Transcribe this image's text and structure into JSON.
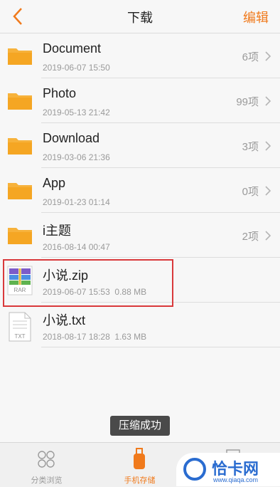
{
  "header": {
    "title": "下载",
    "edit_label": "编辑"
  },
  "files": [
    {
      "name": "Document",
      "date": "2019-06-07 15:50",
      "count": "6项",
      "icon": "folder-icon"
    },
    {
      "name": "Photo",
      "date": "2019-05-13 21:42",
      "count": "99项",
      "icon": "folder-icon"
    },
    {
      "name": "Download",
      "date": "2019-03-06 21:36",
      "count": "3项",
      "icon": "folder-icon"
    },
    {
      "name": "App",
      "date": "2019-01-23 01:14",
      "count": "0项",
      "icon": "folder-icon"
    },
    {
      "name": "i主题",
      "date": "2016-08-14 00:47",
      "count": "2项",
      "icon": "folder-icon"
    },
    {
      "name": "小说.zip",
      "date": "2019-06-07 15:53",
      "size": "0.88 MB",
      "icon": "rar-icon",
      "icon_label": "RAR"
    },
    {
      "name": "小说.txt",
      "date": "2018-08-17 18:28",
      "size": "1.63 MB",
      "icon": "txt-icon",
      "icon_label": "TXT"
    }
  ],
  "toast": "压缩成功",
  "tabs": [
    {
      "label": "分类浏览",
      "icon": "grid-icon",
      "active": false
    },
    {
      "label": "手机存储",
      "icon": "phone-storage-icon",
      "active": true
    },
    {
      "label": "",
      "icon": "document-icon",
      "active": false
    }
  ],
  "watermark": {
    "text": "恰卡网",
    "sub": "www.qiaqa.com"
  },
  "colors": {
    "accent": "#f07a1c",
    "folder": "#f5a623",
    "highlight_border": "#d9393b"
  }
}
